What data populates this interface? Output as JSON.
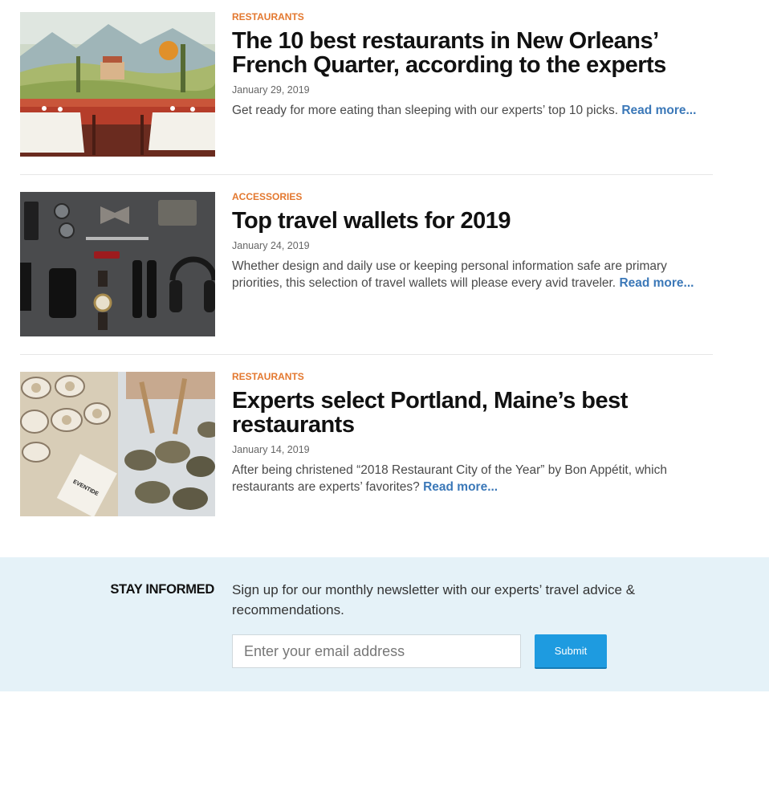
{
  "articles": [
    {
      "category": "RESTAURANTS",
      "title": "The 10 best restaurants in New Orleans’ French Quarter, according to the experts",
      "date": "January 29, 2019",
      "excerpt": "Get ready for more eating than sleeping with our experts’ top 10 picks.",
      "read_more": "Read more..."
    },
    {
      "category": "ACCESSORIES",
      "title": "Top travel wallets for 2019",
      "date": "January 24, 2019",
      "excerpt": "Whether design and daily use or keeping personal information safe are primary priorities, this selection of travel wallets will please every avid traveler.",
      "read_more": "Read more..."
    },
    {
      "category": "RESTAURANTS",
      "title": "Experts select Portland, Maine’s best restaurants",
      "date": "January 14, 2019",
      "excerpt": "After being christened “2018 Restaurant City of the Year” by Bon Appétit, which restaurants are experts’ favorites?",
      "read_more": "Read more..."
    }
  ],
  "image_text": {
    "menu_brand": "EVENTIDE"
  },
  "newsletter": {
    "heading": "STAY INFORMED",
    "description": "Sign up for our monthly newsletter with our experts’ travel advice & recommendations.",
    "email_placeholder": "Enter your email address",
    "submit_label": "Submit"
  },
  "colors": {
    "category": "#e3782f",
    "link": "#3b78b8",
    "newsletter_bg": "#e5f2f8",
    "submit_bg": "#1e9be0"
  }
}
